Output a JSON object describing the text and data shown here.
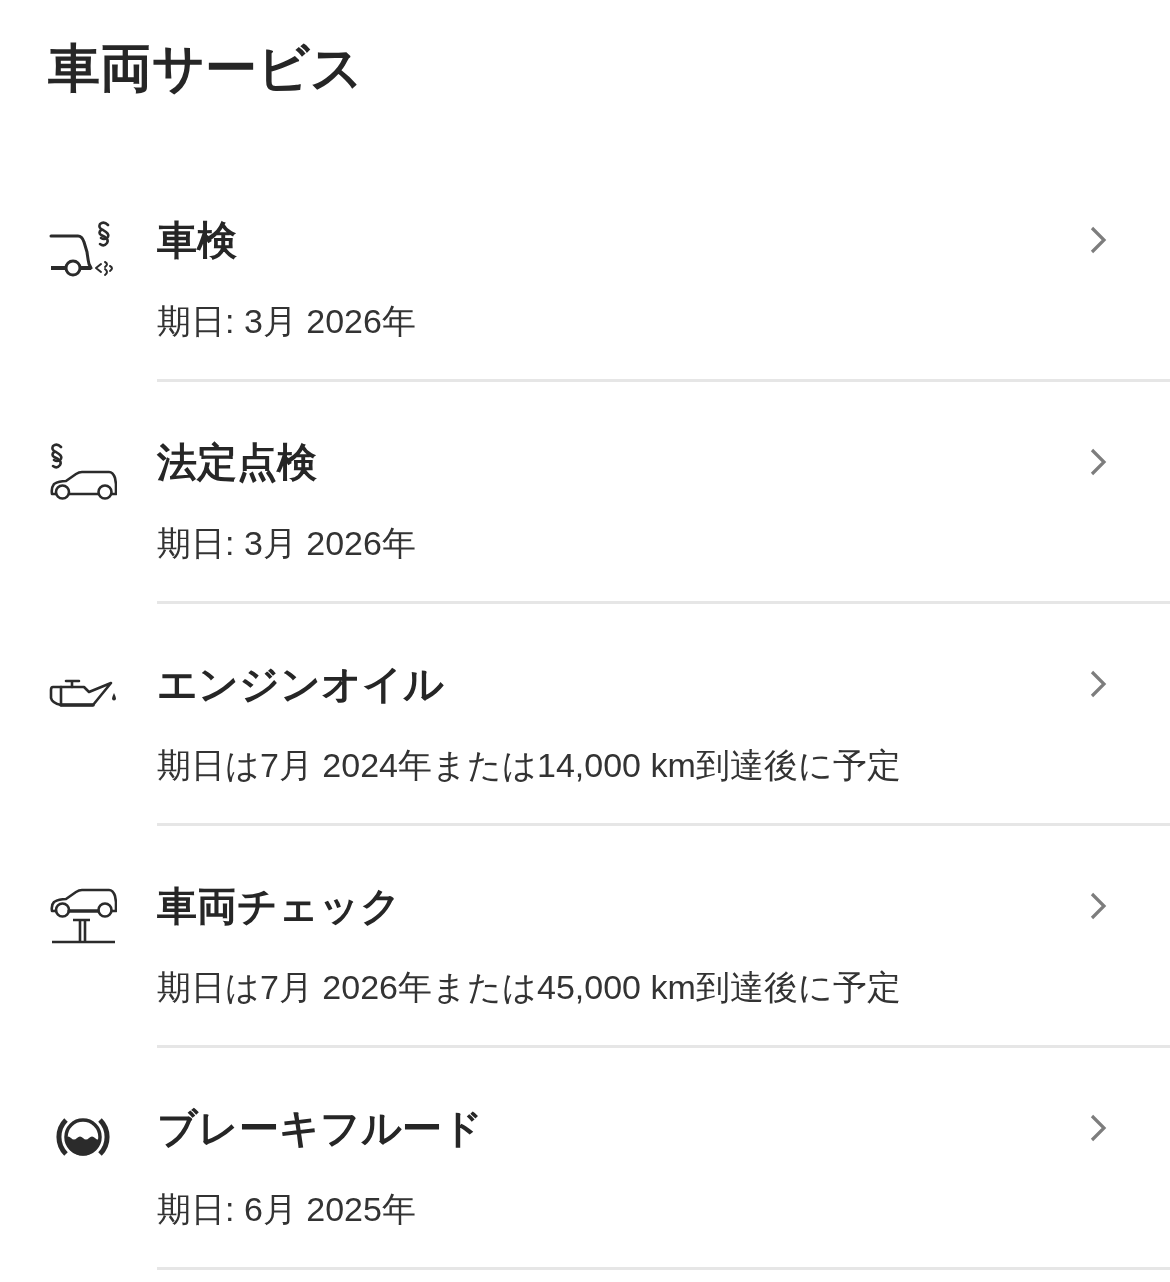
{
  "page": {
    "title": "車両サービス"
  },
  "services": [
    {
      "kind": "emissions",
      "title": "車検",
      "due": "期日: 3月 2026年"
    },
    {
      "kind": "legal",
      "title": "法定点検",
      "due": "期日: 3月 2026年"
    },
    {
      "kind": "oil",
      "title": "エンジンオイル",
      "due": "期日は7月 2024年または14,000 km到達後に予定"
    },
    {
      "kind": "lift",
      "title": "車両チェック",
      "due": "期日は7月 2026年または45,000 km到達後に予定"
    },
    {
      "kind": "brake_fluid",
      "title": "ブレーキフルード",
      "due": "期日: 6月 2025年"
    }
  ]
}
